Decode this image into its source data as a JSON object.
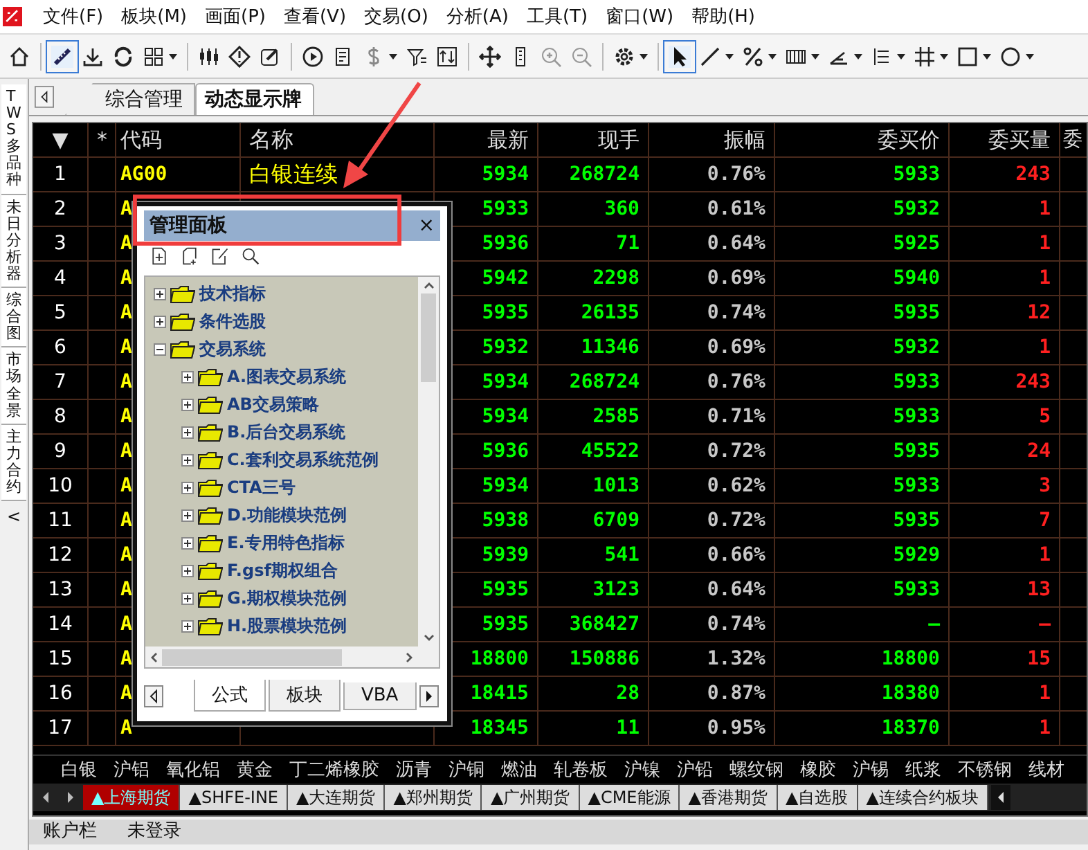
{
  "menu": [
    "文件(F)",
    "板块(M)",
    "画面(P)",
    "查看(V)",
    "交易(O)",
    "分析(A)",
    "工具(T)",
    "窗口(W)",
    "帮助(H)"
  ],
  "side_tabs": [
    "TWS多品种",
    "未日分析器",
    "综合图",
    "市场全景",
    "主力合约"
  ],
  "side_collapse": "<",
  "view_tabs": [
    {
      "label": "综合管理",
      "selected": false
    },
    {
      "label": "动态显示牌",
      "selected": true
    }
  ],
  "table": {
    "columns": [
      "▼",
      "*",
      "代码",
      "名称",
      "最新",
      "现手",
      "振幅",
      "委买价",
      "委买量",
      "委"
    ],
    "rows": [
      {
        "no": "1",
        "code": "AG00",
        "name": "白银连续",
        "last": "5934",
        "vol": "268724",
        "amp": "0.76%",
        "bid": "5933",
        "bid_qty": "243"
      },
      {
        "no": "2",
        "code": "A",
        "last": "5933",
        "vol": "360",
        "amp": "0.61%",
        "bid": "5932",
        "bid_qty": "1"
      },
      {
        "no": "3",
        "code": "A",
        "last": "5936",
        "vol": "71",
        "amp": "0.64%",
        "bid": "5925",
        "bid_qty": "1"
      },
      {
        "no": "4",
        "code": "A",
        "last": "5942",
        "vol": "2298",
        "amp": "0.69%",
        "bid": "5940",
        "bid_qty": "1"
      },
      {
        "no": "5",
        "code": "A",
        "last": "5935",
        "vol": "26135",
        "amp": "0.74%",
        "bid": "5935",
        "bid_qty": "12"
      },
      {
        "no": "6",
        "code": "A",
        "last": "5932",
        "vol": "11346",
        "amp": "0.69%",
        "bid": "5932",
        "bid_qty": "1"
      },
      {
        "no": "7",
        "code": "A",
        "last": "5934",
        "vol": "268724",
        "amp": "0.76%",
        "bid": "5933",
        "bid_qty": "243"
      },
      {
        "no": "8",
        "code": "A",
        "last": "5934",
        "vol": "2585",
        "amp": "0.71%",
        "bid": "5933",
        "bid_qty": "5"
      },
      {
        "no": "9",
        "code": "A",
        "last": "5936",
        "vol": "45522",
        "amp": "0.72%",
        "bid": "5935",
        "bid_qty": "24"
      },
      {
        "no": "10",
        "code": "A",
        "last": "5934",
        "vol": "1013",
        "amp": "0.62%",
        "bid": "5933",
        "bid_qty": "3"
      },
      {
        "no": "11",
        "code": "A",
        "last": "5938",
        "vol": "6709",
        "amp": "0.72%",
        "bid": "5935",
        "bid_qty": "7"
      },
      {
        "no": "12",
        "code": "A",
        "last": "5939",
        "vol": "541",
        "amp": "0.66%",
        "bid": "5929",
        "bid_qty": "1"
      },
      {
        "no": "13",
        "code": "A",
        "last": "5935",
        "vol": "3123",
        "amp": "0.64%",
        "bid": "5933",
        "bid_qty": "13"
      },
      {
        "no": "14",
        "code": "A",
        "last": "5935",
        "vol": "368427",
        "amp": "0.74%",
        "bid": "—",
        "bid_qty": "—"
      },
      {
        "no": "15",
        "code": "A",
        "last": "18800",
        "vol": "150886",
        "amp": "1.32%",
        "bid": "18800",
        "bid_qty": "15"
      },
      {
        "no": "16",
        "code": "A",
        "last": "18415",
        "vol": "28",
        "amp": "0.87%",
        "bid": "18380",
        "bid_qty": "1"
      },
      {
        "no": "17",
        "code": "A",
        "last": "18345",
        "vol": "11",
        "amp": "0.95%",
        "bid": "18370",
        "bid_qty": "1"
      }
    ]
  },
  "categories": [
    "白银",
    "沪铝",
    "氧化铝",
    "黄金",
    "丁二烯橡胶",
    "沥青",
    "沪铜",
    "燃油",
    "轧卷板",
    "沪镍",
    "沪铅",
    "螺纹钢",
    "橡胶",
    "沪锡",
    "纸浆",
    "不锈钢",
    "线材"
  ],
  "market_tabs": [
    {
      "label": "▲上海期货",
      "selected": true
    },
    {
      "label": "▲SHFE-INE",
      "selected": false
    },
    {
      "label": "▲大连期货",
      "selected": false
    },
    {
      "label": "▲郑州期货",
      "selected": false
    },
    {
      "label": "▲广州期货",
      "selected": false
    },
    {
      "label": "▲CME能源",
      "selected": false
    },
    {
      "label": "▲香港期货",
      "selected": false
    },
    {
      "label": "▲自选股",
      "selected": false
    },
    {
      "label": "▲连续合约板块",
      "selected": false
    }
  ],
  "status_bar": [
    "账户栏",
    "未登录"
  ],
  "panel": {
    "title": "管理面板",
    "close": "×",
    "tree": [
      {
        "label": "技术指标",
        "expanded": false
      },
      {
        "label": "条件选股",
        "expanded": false
      },
      {
        "label": "交易系统",
        "expanded": true,
        "children": [
          {
            "label": "A.图表交易系统",
            "expanded": false
          },
          {
            "label": "AB交易策略",
            "expanded": false
          },
          {
            "label": "B.后台交易系统",
            "expanded": false
          },
          {
            "label": "C.套利交易系统范例",
            "expanded": false
          },
          {
            "label": "CTA三号",
            "expanded": false
          },
          {
            "label": "D.功能模块范例",
            "expanded": false
          },
          {
            "label": "E.专用特色指标",
            "expanded": false
          },
          {
            "label": "F.gsf期权组合",
            "expanded": false
          },
          {
            "label": "G.期权模块范例",
            "expanded": false
          },
          {
            "label": "H.股票模块范例",
            "expanded": false
          }
        ]
      }
    ],
    "tabs": [
      {
        "label": "公式",
        "selected": true
      },
      {
        "label": "板块",
        "selected": false
      },
      {
        "label": "VBA",
        "selected": false
      }
    ]
  }
}
